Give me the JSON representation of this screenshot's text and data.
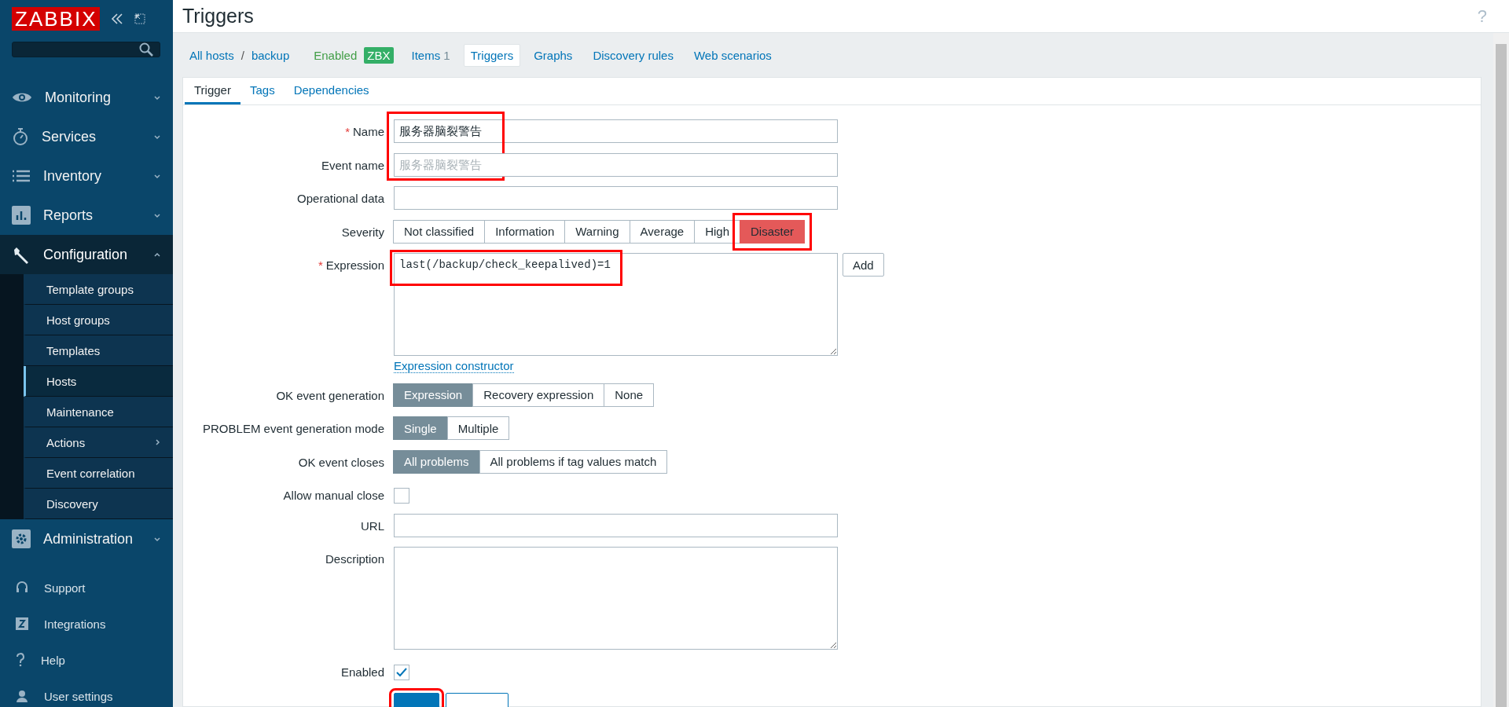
{
  "sidebar": {
    "logo": "ZABBIX",
    "menu": [
      {
        "label": "Monitoring",
        "expanded": false
      },
      {
        "label": "Services",
        "expanded": false
      },
      {
        "label": "Inventory",
        "expanded": false
      },
      {
        "label": "Reports",
        "expanded": false
      },
      {
        "label": "Configuration",
        "expanded": true,
        "children": [
          {
            "label": "Template groups",
            "selected": false,
            "submenu": false
          },
          {
            "label": "Host groups",
            "selected": false,
            "submenu": false
          },
          {
            "label": "Templates",
            "selected": false,
            "submenu": false
          },
          {
            "label": "Hosts",
            "selected": true,
            "submenu": false
          },
          {
            "label": "Maintenance",
            "selected": false,
            "submenu": false
          },
          {
            "label": "Actions",
            "selected": false,
            "submenu": true
          },
          {
            "label": "Event correlation",
            "selected": false,
            "submenu": false
          },
          {
            "label": "Discovery",
            "selected": false,
            "submenu": false
          }
        ]
      },
      {
        "label": "Administration",
        "expanded": false
      }
    ],
    "footer": [
      {
        "label": "Support"
      },
      {
        "label": "Integrations"
      },
      {
        "label": "Help"
      },
      {
        "label": "User settings"
      }
    ]
  },
  "header": {
    "title": "Triggers",
    "help": "?"
  },
  "host_nav": {
    "breadcrumbs": [
      "All hosts",
      "backup"
    ],
    "separator": "/",
    "status": "Enabled",
    "badge": "ZBX",
    "tabs": [
      {
        "label": "Items",
        "count": "1",
        "selected": false
      },
      {
        "label": "Triggers",
        "selected": true
      },
      {
        "label": "Graphs",
        "selected": false
      },
      {
        "label": "Discovery rules",
        "selected": false
      },
      {
        "label": "Web scenarios",
        "selected": false
      }
    ]
  },
  "form_tabs": [
    {
      "label": "Trigger",
      "selected": true
    },
    {
      "label": "Tags",
      "selected": false
    },
    {
      "label": "Dependencies",
      "selected": false
    }
  ],
  "form": [
    {
      "kind": "text",
      "label": "Name",
      "required_mark": "*",
      "value": "服务器脑裂警告",
      "highlighted": true
    },
    {
      "kind": "text",
      "label": "Event name",
      "placeholder": "服务器脑裂警告"
    },
    {
      "kind": "text",
      "label": "Operational data"
    },
    {
      "kind": "severity",
      "label": "Severity",
      "options": [
        {
          "label": "Not classified",
          "selected": false
        },
        {
          "label": "Information",
          "selected": false
        },
        {
          "label": "Warning",
          "selected": false
        },
        {
          "label": "Average",
          "selected": false
        },
        {
          "label": "High",
          "selected": false
        },
        {
          "label": "Disaster",
          "selected": true
        }
      ],
      "highlighted": true
    },
    {
      "kind": "expression",
      "label": "Expression",
      "required_mark": "*",
      "value": "last(/backup/check_keepalived)=1",
      "button": "Add",
      "link": "Expression constructor",
      "highlighted": true
    },
    {
      "kind": "segmented",
      "label": "OK event generation",
      "options": [
        {
          "label": "Expression",
          "selected": true
        },
        {
          "label": "Recovery expression",
          "selected": false
        },
        {
          "label": "None",
          "selected": false
        }
      ]
    },
    {
      "kind": "segmented",
      "label": "PROBLEM event generation mode",
      "options": [
        {
          "label": "Single",
          "selected": true
        },
        {
          "label": "Multiple",
          "selected": false
        }
      ]
    },
    {
      "kind": "segmented",
      "label": "OK event closes",
      "options": [
        {
          "label": "All problems",
          "selected": true
        },
        {
          "label": "All problems if tag values match",
          "selected": false
        }
      ]
    },
    {
      "kind": "checkbox",
      "label": "Allow manual close",
      "checked": false
    },
    {
      "kind": "text",
      "label": "URL"
    },
    {
      "kind": "textarea",
      "label": "Description"
    },
    {
      "kind": "checkbox",
      "label": "Enabled",
      "checked": true
    }
  ],
  "form_buttons": [
    {
      "kind": "primary",
      "highlighted": true
    },
    {
      "kind": "secondary"
    }
  ]
}
